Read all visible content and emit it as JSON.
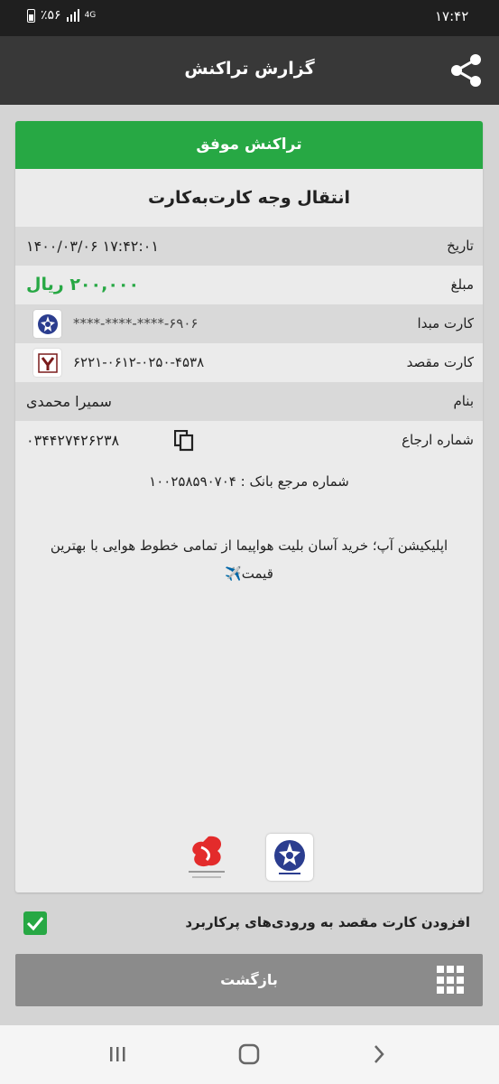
{
  "status_bar": {
    "time": "۱۷:۴۲",
    "battery": "٪۵۶",
    "network": "4G"
  },
  "appbar": {
    "title": "گزارش تراکنش",
    "share_icon": "share-icon"
  },
  "receipt": {
    "status": "تراکنش موفق",
    "title": "انتقال وجه کارت‌به‌کارت",
    "rows": {
      "date_label": "تاریخ",
      "date_value": "۱۴۰۰/۰۳/۰۶ ۱۷:۴۲:۰۱",
      "amount_label": "مبلغ",
      "amount_value": "۲۰۰,۰۰۰ ریال",
      "source_label": "کارت مبدا",
      "source_value": "****-****-****-۶۹۰۶",
      "dest_label": "کارت مقصد",
      "dest_value": "۶۲۲۱-۰۶۱۲-۰۲۵۰-۴۵۳۸",
      "name_label": "بنام",
      "name_value": "سمیرا محمدی",
      "ref_label": "شماره ارجاع",
      "ref_value": "۰۳۴۴۲۷۴۲۶۲۳۸"
    },
    "bank_ref": "شماره مرجع بانک : ۱۰۰۲۵۸۵۹۰۷۰۴",
    "promo": "اپلیکیشن آپ؛ خرید آسان بلیت هواپیما از تمامی خطوط هوایی با بهترین قیمت✈️",
    "footer_logos": [
      "asan-pardakht-logo",
      "bank-logo"
    ]
  },
  "favorites": {
    "label": "افزودن کارت مقصد به ورودی‌های پرکاربرد",
    "checked": true
  },
  "back_button": {
    "label": "بازگشت",
    "icon": "grid-icon"
  },
  "colors": {
    "success": "#27a844",
    "appbar": "#383838",
    "status_bar": "#1f1f1f",
    "button": "#8b8b8b"
  }
}
